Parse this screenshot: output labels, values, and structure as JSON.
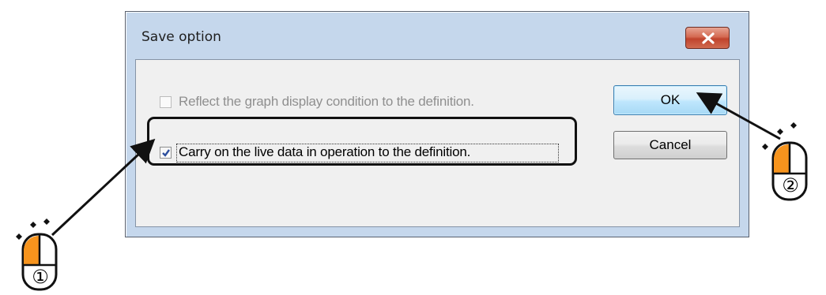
{
  "dialog": {
    "title": "Save option",
    "options": [
      {
        "label": "Reflect the graph display condition to the definition.",
        "checked": false,
        "enabled": false
      },
      {
        "label": "Carry on the live data in operation to the definition.",
        "checked": true,
        "enabled": true
      }
    ],
    "ok_label": "OK",
    "cancel_label": "Cancel"
  },
  "annotations": {
    "step1": "①",
    "step2": "②",
    "mouse_accent_color": "#f7941d",
    "highlight_color": "#111111"
  }
}
